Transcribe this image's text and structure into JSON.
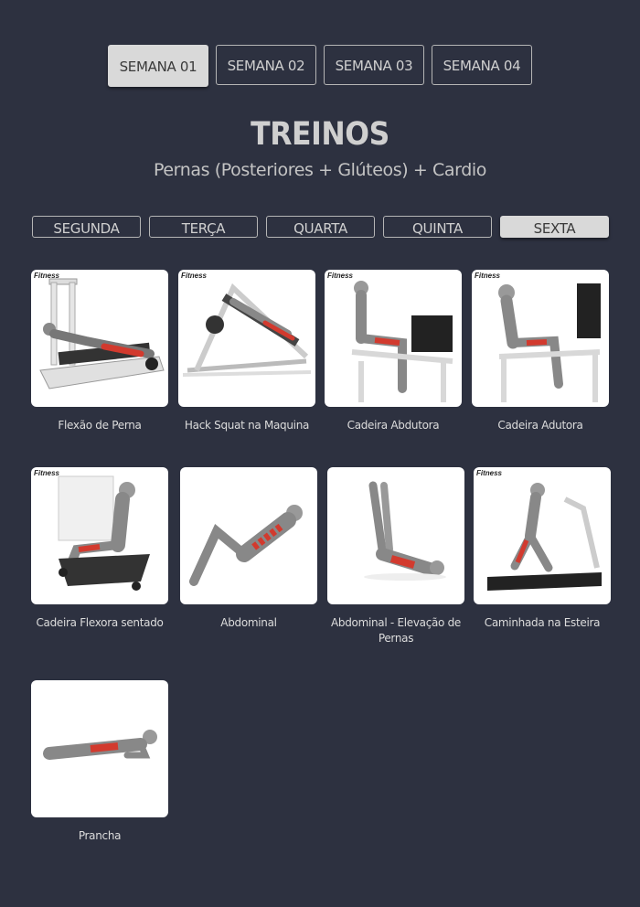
{
  "weeks": [
    {
      "label": "SEMANA 01",
      "active": true
    },
    {
      "label": "SEMANA 02",
      "active": false
    },
    {
      "label": "SEMANA 03",
      "active": false
    },
    {
      "label": "SEMANA 04",
      "active": false
    }
  ],
  "title": "TREINOS",
  "subtitle": "Pernas (Posteriores + Glúteos) + Cardio",
  "days": [
    {
      "label": "SEGUNDA",
      "active": false
    },
    {
      "label": "TERÇA",
      "active": false
    },
    {
      "label": "QUARTA",
      "active": false
    },
    {
      "label": "QUINTA",
      "active": false
    },
    {
      "label": "SEXTA",
      "active": true
    }
  ],
  "exercises": [
    {
      "name": "Flexão de Perna",
      "brand": "Fitness"
    },
    {
      "name": "Hack Squat na Maquina",
      "brand": "Fitness"
    },
    {
      "name": "Cadeira Abdutora",
      "brand": "Fitness"
    },
    {
      "name": "Cadeira Adutora",
      "brand": "Fitness"
    },
    {
      "name": "Cadeira Flexora sentado",
      "brand": "Fitness"
    },
    {
      "name": "Abdominal",
      "brand": ""
    },
    {
      "name": "Abdominal - Elevação de Pernas",
      "brand": ""
    },
    {
      "name": "Caminhada na Esteira",
      "brand": "Fitness"
    },
    {
      "name": "Prancha",
      "brand": ""
    }
  ],
  "colors": {
    "background": "#2d3140",
    "active_button": "#d9d9d9",
    "muscle_highlight": "#d23a2e"
  }
}
